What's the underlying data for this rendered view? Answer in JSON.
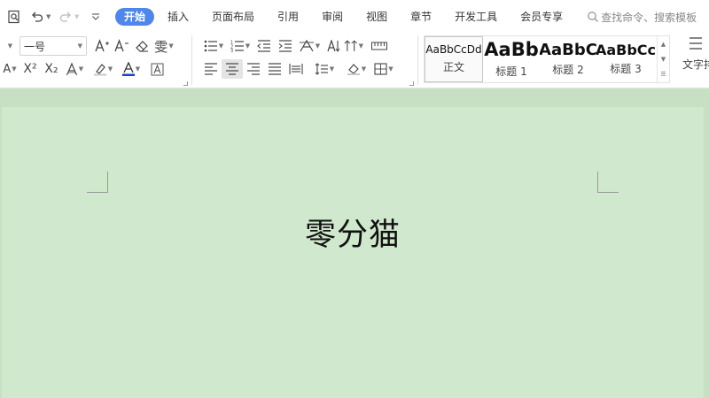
{
  "menubar": {
    "tabs": [
      {
        "label": "开始",
        "active": true
      },
      {
        "label": "插入"
      },
      {
        "label": "页面布局"
      },
      {
        "label": "引用"
      },
      {
        "label": "审阅"
      },
      {
        "label": "视图"
      },
      {
        "label": "章节"
      },
      {
        "label": "开发工具"
      },
      {
        "label": "会员专享"
      }
    ],
    "search_label": "查找命令、搜索模板"
  },
  "ribbon": {
    "font_size_value": "一号",
    "text_color": "#1a3fd6",
    "styles": [
      {
        "sample": "AaBbCcDd",
        "name": "正文"
      },
      {
        "sample": "AaBb",
        "name": "标题 1"
      },
      {
        "sample": "AaBbC",
        "name": "标题 2"
      },
      {
        "sample": "AaBbCc",
        "name": "标题 3"
      }
    ],
    "textbox_label": "文字排"
  },
  "document": {
    "title": "零分猫"
  },
  "colors": {
    "accent": "#4f86e8",
    "page_bg": "#d0e8cd"
  }
}
